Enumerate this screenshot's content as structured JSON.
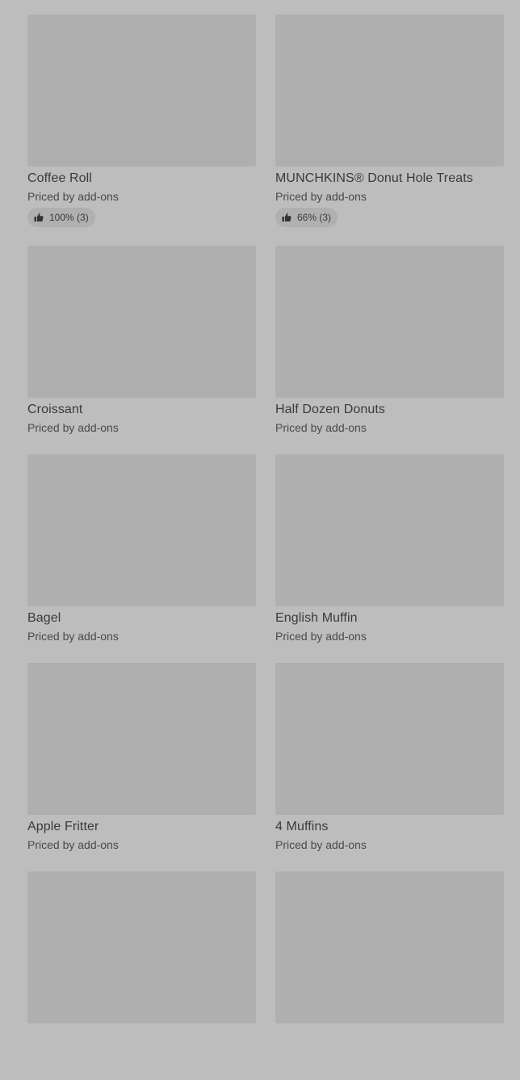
{
  "items": [
    {
      "name": "Coffee Roll",
      "price": "Priced by add-ons",
      "rating": "100% (3)"
    },
    {
      "name": "MUNCHKINS® Donut Hole Treats",
      "price": "Priced by add-ons",
      "rating": "66% (3)"
    },
    {
      "name": "Croissant",
      "price": "Priced by add-ons"
    },
    {
      "name": "Half Dozen Donuts",
      "price": "Priced by add-ons"
    },
    {
      "name": "Bagel",
      "price": "Priced by add-ons"
    },
    {
      "name": "English Muffin",
      "price": "Priced by add-ons"
    },
    {
      "name": "Apple Fritter",
      "price": "Priced by add-ons"
    },
    {
      "name": "4 Muffins",
      "price": "Priced by add-ons"
    },
    {
      "name": "",
      "price": ""
    },
    {
      "name": "",
      "price": ""
    }
  ],
  "icons": {
    "rating": "thumbs-up-icon"
  },
  "colors": {
    "background": "#bdbdbd",
    "image_placeholder": "#afafaf",
    "text": "#3a3a3a"
  }
}
